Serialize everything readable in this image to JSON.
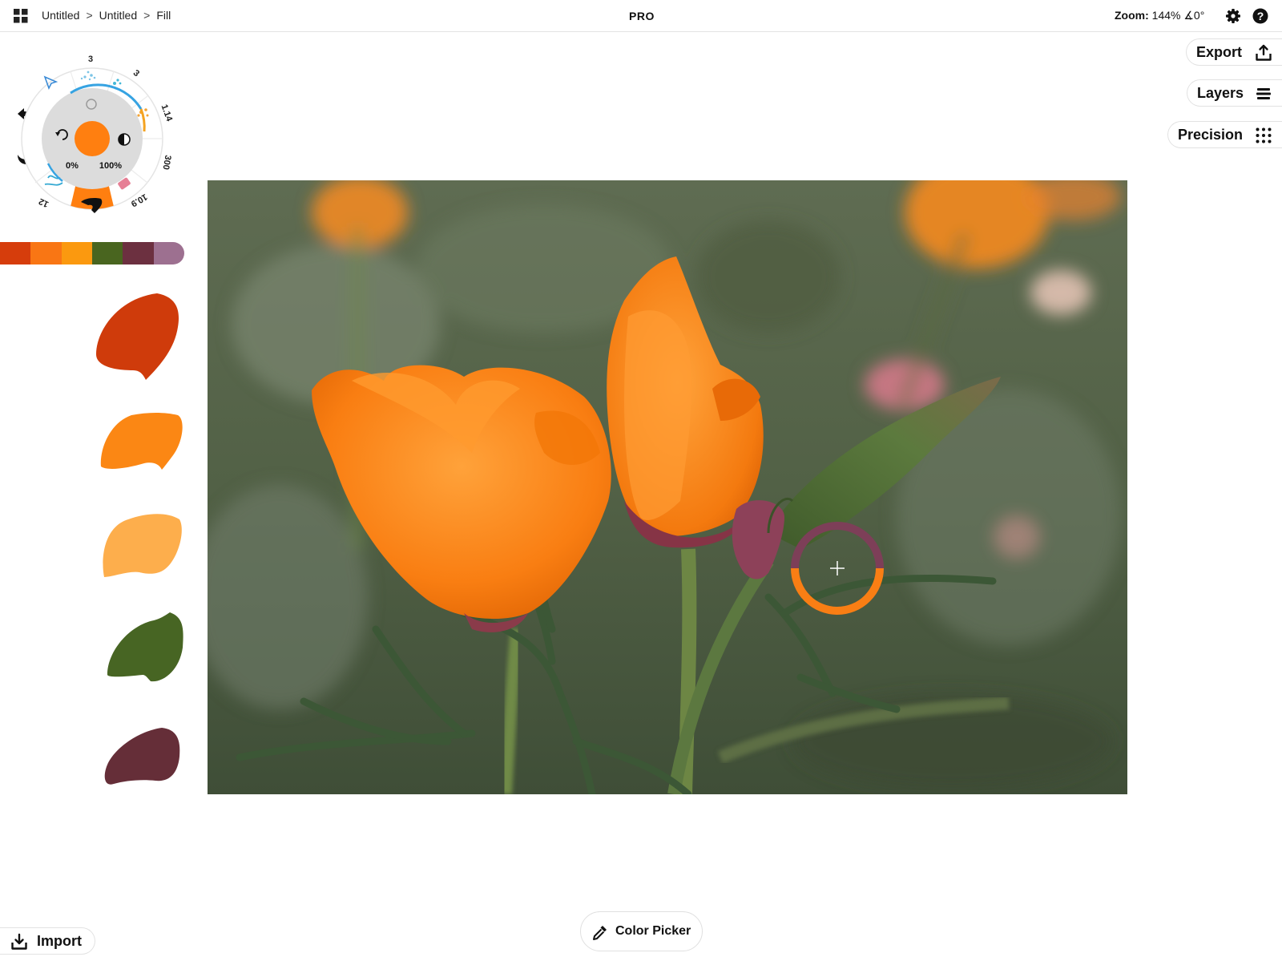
{
  "topbar": {
    "breadcrumb": [
      "Untitled",
      "Untitled",
      "Fill"
    ],
    "separator": ">",
    "badge": "PRO",
    "zoom_label": "Zoom:",
    "zoom_value": "144%",
    "angle_value": "∡0°"
  },
  "right_panel": {
    "export_label": "Export",
    "layers_label": "Layers",
    "precision_label": "Precision"
  },
  "tool_wheel": {
    "tool_sizes": [
      "3",
      "3",
      "1.14",
      "300",
      "10.9",
      "12"
    ],
    "opacity_value": "0%",
    "smoothing_value": "100%",
    "active_color": "#ff7f10"
  },
  "palette": {
    "colors": [
      "#d63d0c",
      "#f97614",
      "#fb990f",
      "#49651f",
      "#6c3040",
      "#9d7090"
    ]
  },
  "swatches": {
    "colors": [
      "#cf3b0b",
      "#fb8714",
      "#fdae4c",
      "#476523",
      "#652e38"
    ]
  },
  "canvas": {
    "content": "poppy-photo"
  },
  "loupe": {
    "top_color": "#7d3f58",
    "bottom_color": "#f97e14"
  },
  "bottom": {
    "import_label": "Import",
    "color_picker_label": "Color Picker"
  },
  "icons": {
    "menu": "grid-icon",
    "settings": "gear-icon",
    "help": "question-icon",
    "export": "upload-icon",
    "layers": "stack-icon",
    "precision": "dots-grid-icon",
    "undo": "undo-arrow-icon",
    "redo": "redo-arrow-icon",
    "import": "download-icon",
    "color_picker": "eyedropper-icon"
  }
}
